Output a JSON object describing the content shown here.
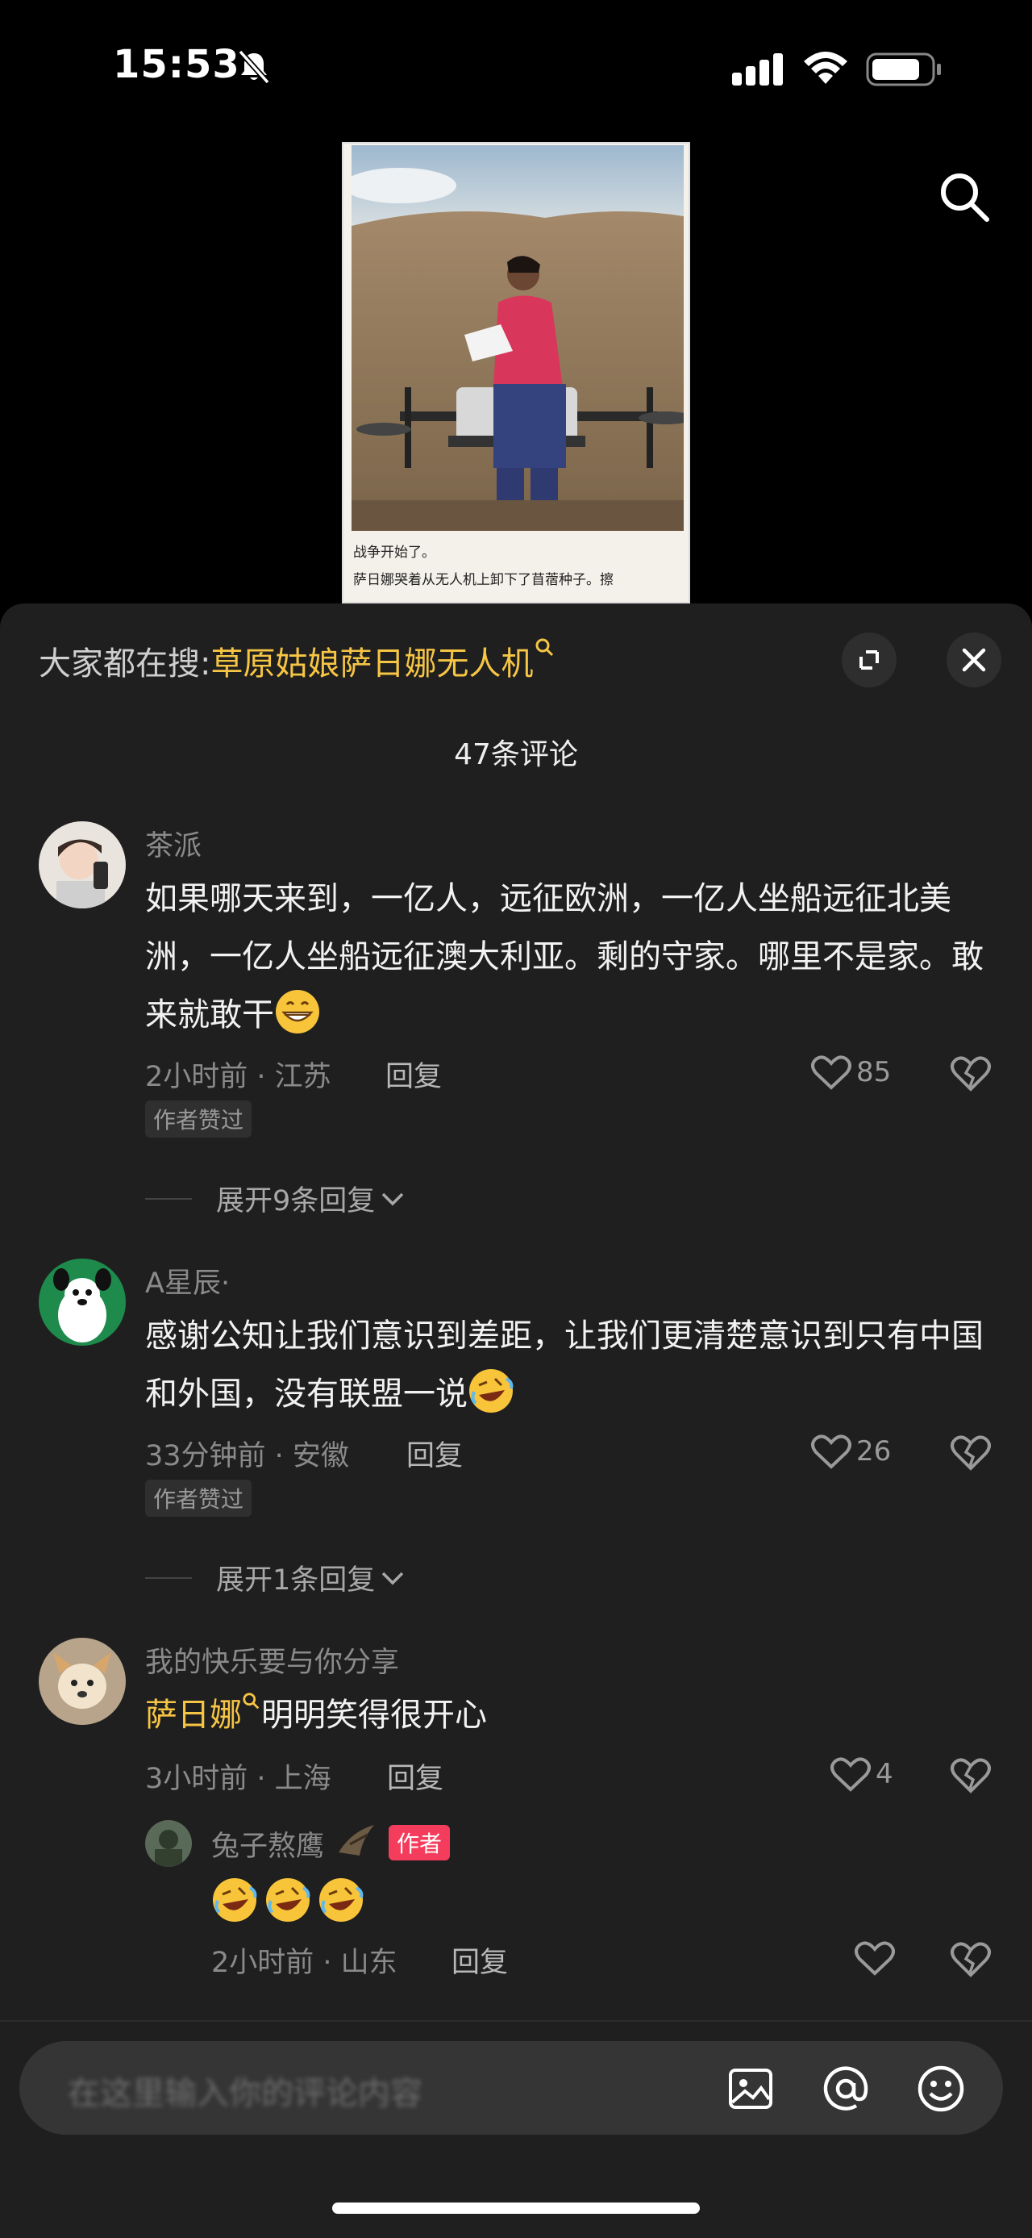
{
  "status_bar": {
    "time": "15:53",
    "icons": [
      "bell-slash-icon",
      "cellular-signal-icon",
      "wifi-icon",
      "battery-icon"
    ]
  },
  "video": {
    "caption_line1": "战争开始了。",
    "caption_line2": "萨日娜哭着从无人机上卸下了苜蓿种子。擦",
    "search_icon": "search-icon"
  },
  "panel": {
    "search_hint_prefix": "大家都在搜:",
    "search_hint_term": "草原姑娘萨日娜无人机",
    "comment_count": "47条评论"
  },
  "comments": [
    {
      "username": "茶派",
      "text": "如果哪天来到，一亿人，远征欧洲，一亿人坐船远征北美洲，一亿人坐船远征澳大利亚。剩的守家。哪里不是家。敢来就敢干",
      "meta": "2小时前 · 江苏",
      "reply_label": "回复",
      "likes": "85",
      "badge": "作者赞过",
      "expand_label": "展开9条回复"
    },
    {
      "username": "A星辰·",
      "text": "感谢公知让我们意识到差距，让我们更清楚意识到只有中国和外国，没有联盟一说",
      "meta": "33分钟前 · 安徽",
      "reply_label": "回复",
      "likes": "26",
      "badge": "作者赞过",
      "expand_label": "展开1条回复"
    },
    {
      "username": "我的快乐要与你分享",
      "mention": "萨日娜",
      "text": "明明笑得很开心",
      "meta": "3小时前 · 上海",
      "reply_label": "回复",
      "likes": "4",
      "reply": {
        "username": "兔子熬鹰",
        "author_badge": "作者",
        "meta": "2小时前 · 山东",
        "reply_label": "回复"
      }
    }
  ],
  "input_bar": {
    "placeholder": "在这里输入你的评论内容",
    "icons": [
      "image-icon",
      "at-icon",
      "emoji-icon"
    ]
  },
  "colors": {
    "panel_bg": "#1f1f1f",
    "highlight": "#f6c544",
    "author_badge": "#f43d5c"
  }
}
